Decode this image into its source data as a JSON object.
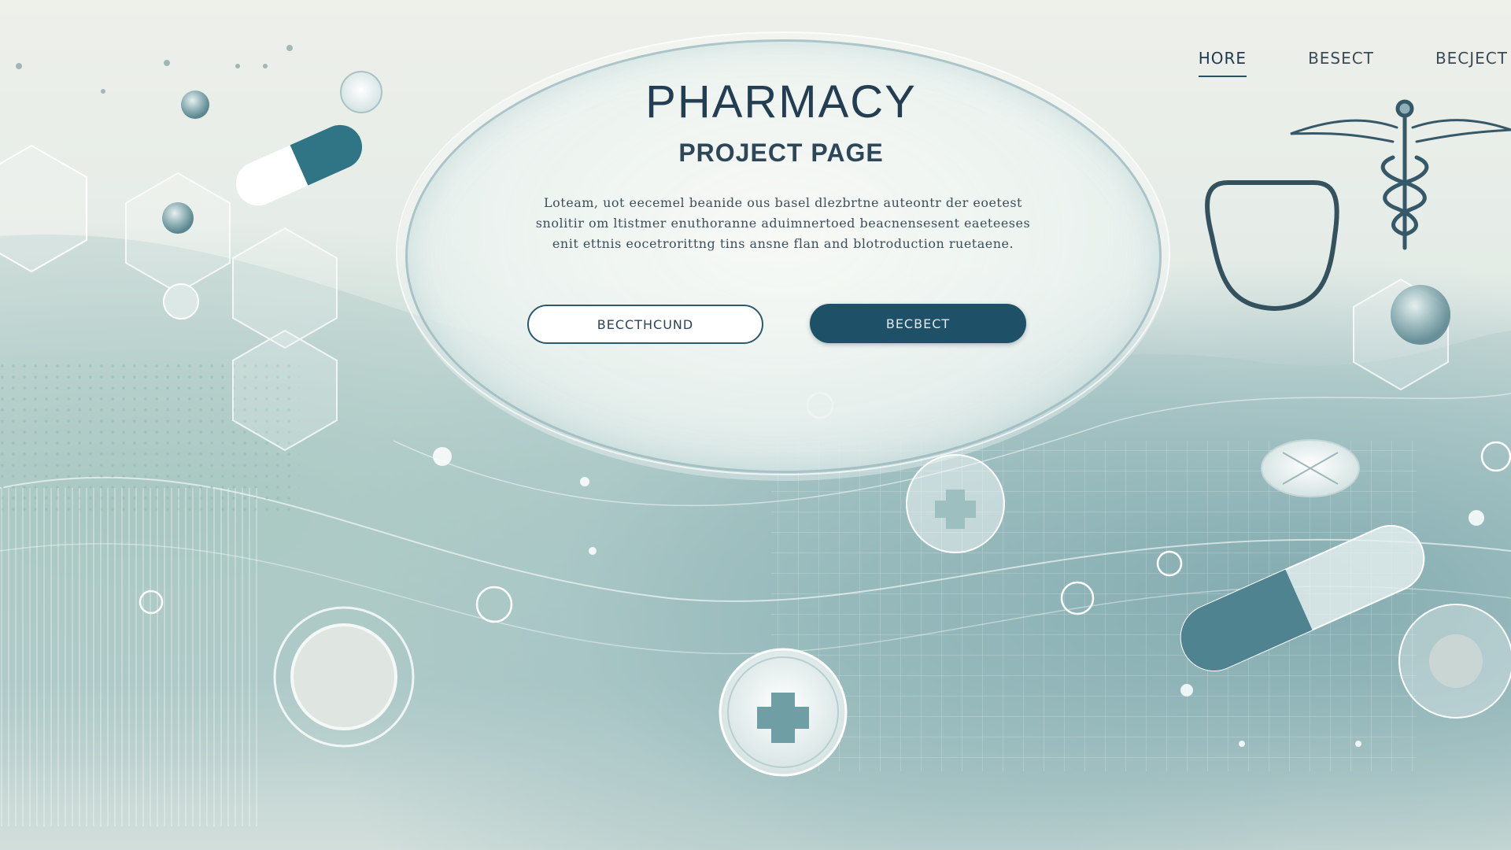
{
  "nav": {
    "items": [
      {
        "label": "HORE",
        "active": true
      },
      {
        "label": "BESECT",
        "active": false
      },
      {
        "label": "BECJECT",
        "active": false
      }
    ]
  },
  "hero": {
    "title": "PHARMACY",
    "subtitle": "PROJECT PAGE",
    "body": "Loteam, uot eecemel beanide ous basel dlezbrtne auteontr der eoetest snolitir om ltistmer enuthoranne aduimnertoed beacnensesent eaeteeses enit ettnis eocetrorittng tins ansne flan and blotroduction ruetaene.",
    "button_primary": "BECCTHCUND",
    "button_secondary": "BECBECT"
  },
  "colors": {
    "accent": "#1e5068",
    "text": "#233e52",
    "teal": "#2f7585"
  },
  "icons": [
    "capsule-icon",
    "caduceus-icon",
    "stethoscope-icon",
    "pill-icon",
    "medical-cross-icon",
    "hexagon-icon"
  ]
}
